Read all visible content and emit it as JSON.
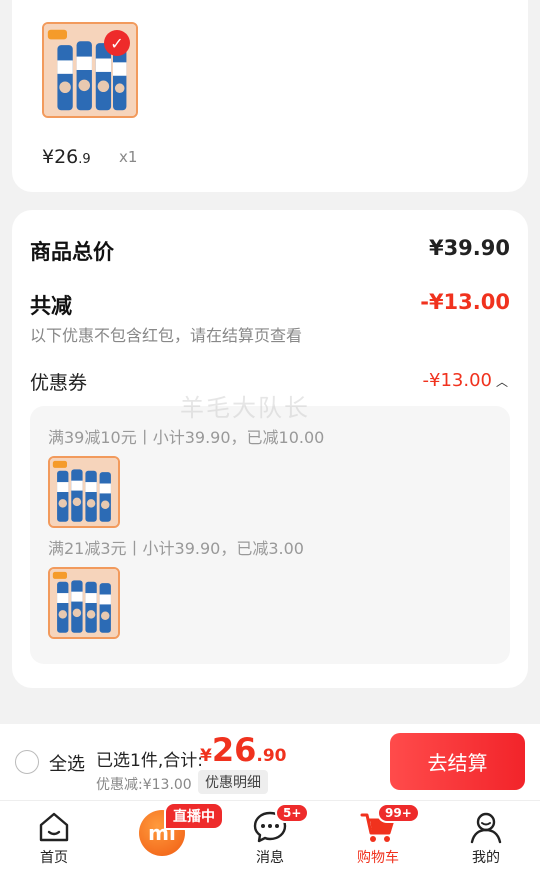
{
  "top_item": {
    "price_int": "¥26",
    "price_dec": ".9",
    "quantity": "x1",
    "selected_icon": "check-icon"
  },
  "summary": {
    "goods_total_label": "商品总价",
    "goods_total_value": "¥39.90",
    "discount_label": "共减",
    "discount_value": "-¥13.00",
    "discount_note": "以下优惠不包含红包，请在结算页查看",
    "coupon_label": "优惠券",
    "coupon_value": "-¥13.00",
    "coupon_rules": [
      "满39减10元丨小计39.90，已减10.00",
      "满21减3元丨小计39.90，已减3.00"
    ]
  },
  "watermark": "羊毛大队长",
  "bottom_bar": {
    "select_all": "全选",
    "selected_info": "已选1件,合计:",
    "total_currency": "¥",
    "total_int": "26",
    "total_dec": ".90",
    "discount_line": "优惠减:¥13.00",
    "discount_detail": "优惠明细",
    "checkout": "去结算"
  },
  "tabbar": {
    "items": [
      {
        "label": "首页",
        "icon": "home-icon"
      },
      {
        "label": "直播中",
        "icon": "mi-logo-icon"
      },
      {
        "label": "消息",
        "icon": "message-icon",
        "badge": "5+"
      },
      {
        "label": "购物车",
        "icon": "cart-icon",
        "badge": "99+",
        "active": true
      },
      {
        "label": "我的",
        "icon": "profile-icon"
      }
    ]
  },
  "colors": {
    "accent": "#f0321e",
    "thumbnail_border": "#f29a5c",
    "background": "#f2f2f2"
  }
}
